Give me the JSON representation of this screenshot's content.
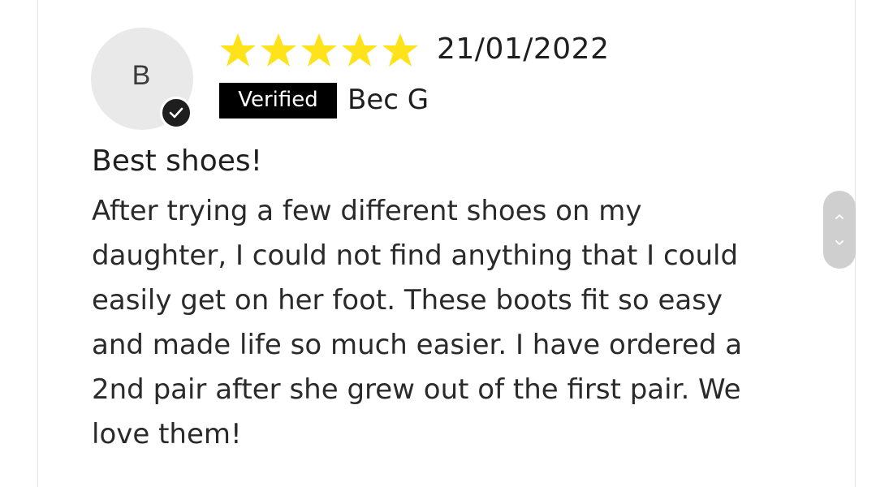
{
  "review": {
    "avatar_initial": "B",
    "rating": 5,
    "rating_max": 5,
    "star_color": "#ffe31a",
    "date": "21/01/2022",
    "verified_label": "Verified",
    "author": "Bec G",
    "title": "Best shoes!",
    "body_lines": [
      "After trying a few different shoes on my",
      "daughter, I could not find anything that I could",
      "easily get on her foot. These boots fit so easy",
      "and made life so much easier. I have ordered a",
      "2nd pair after she grew out of the first pair. We",
      "love them!"
    ]
  },
  "icons": {
    "verified_check": "checkmark-icon",
    "star": "star-icon",
    "up": "chevron-up-icon",
    "down": "chevron-down-icon"
  }
}
